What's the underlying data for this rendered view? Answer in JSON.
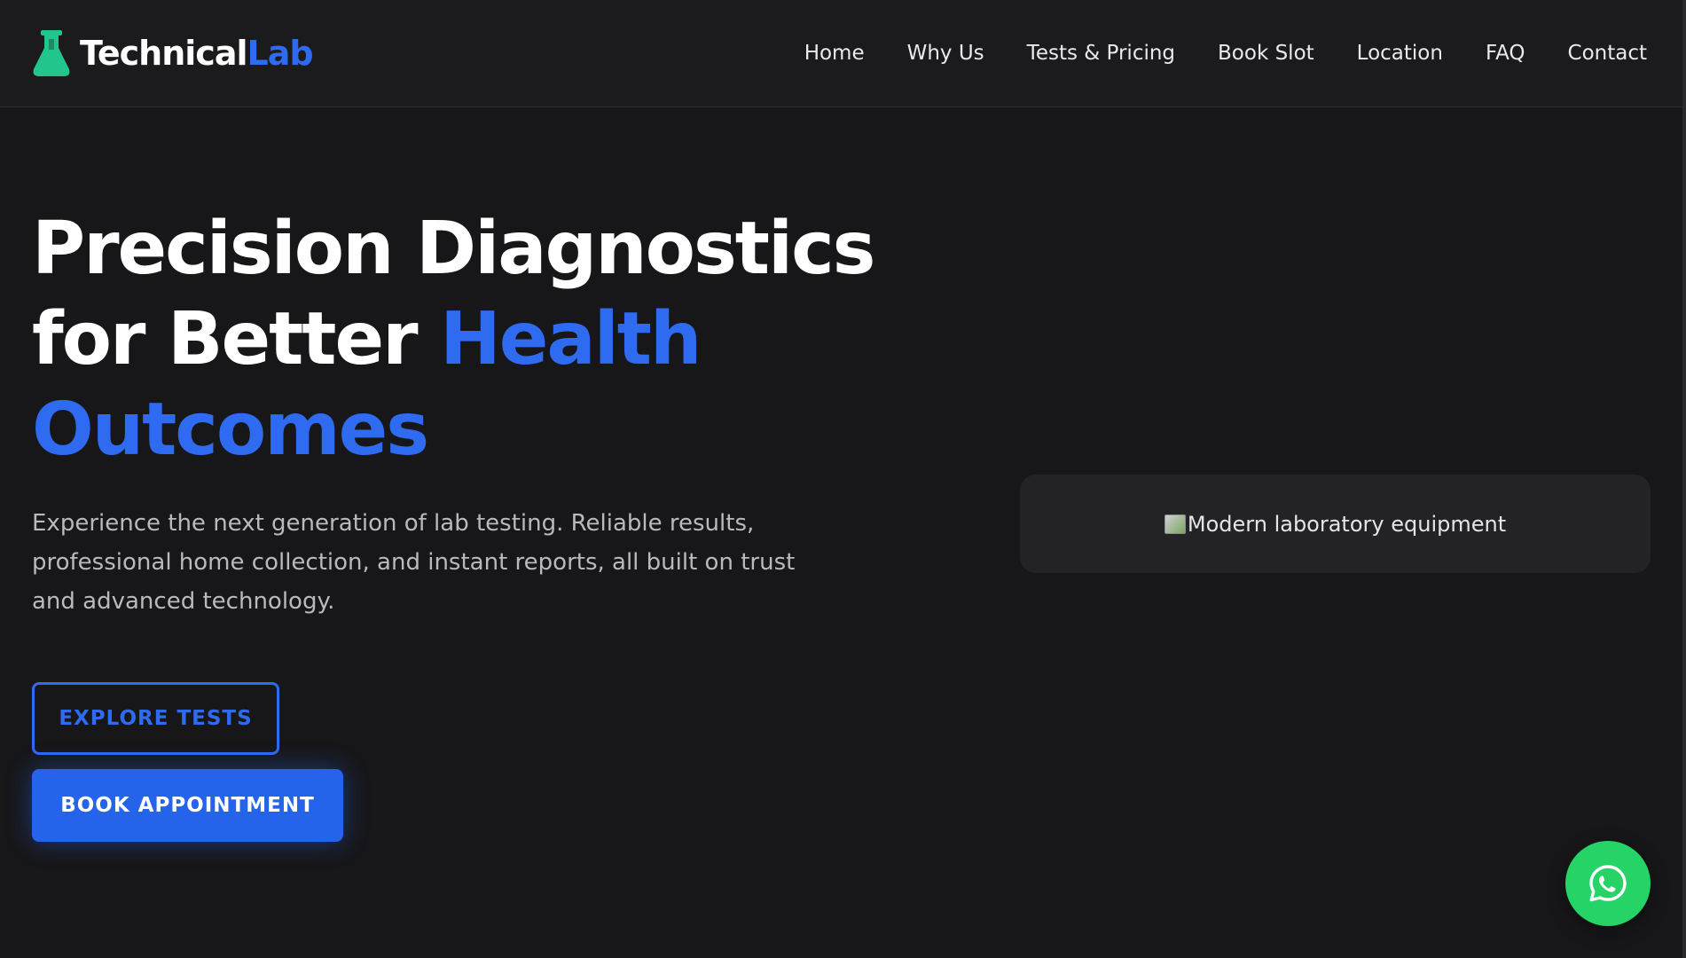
{
  "brand": {
    "name_part1": "Technical",
    "name_part2": "Lab",
    "icon": "flask-icon",
    "accent_color": "#2f6bf0",
    "icon_color": "#22c58b"
  },
  "nav": {
    "items": [
      {
        "label": "Home"
      },
      {
        "label": "Why Us"
      },
      {
        "label": "Tests & Pricing"
      },
      {
        "label": "Book Slot"
      },
      {
        "label": "Location"
      },
      {
        "label": "FAQ"
      },
      {
        "label": "Contact"
      }
    ]
  },
  "scroll_progress": 0.17,
  "hero": {
    "title_line1": "Precision Diagnostics",
    "title_line2_plain": "for Better ",
    "title_line2_accent": "Health",
    "title_line3_accent": "Outcomes",
    "subtitle": "Experience the next generation of lab testing. Reliable results, professional home collection, and instant reports, all built on trust and advanced technology.",
    "primary_cta": "BOOK APPOINTMENT",
    "secondary_cta": "EXPLORE TESTS",
    "image_alt": "Modern laboratory equipment"
  },
  "whatsapp": {
    "icon": "whatsapp-icon",
    "color": "#25d366"
  },
  "colors": {
    "background": "#171719",
    "header": "#1b1b1d",
    "primary": "#2563eb"
  }
}
